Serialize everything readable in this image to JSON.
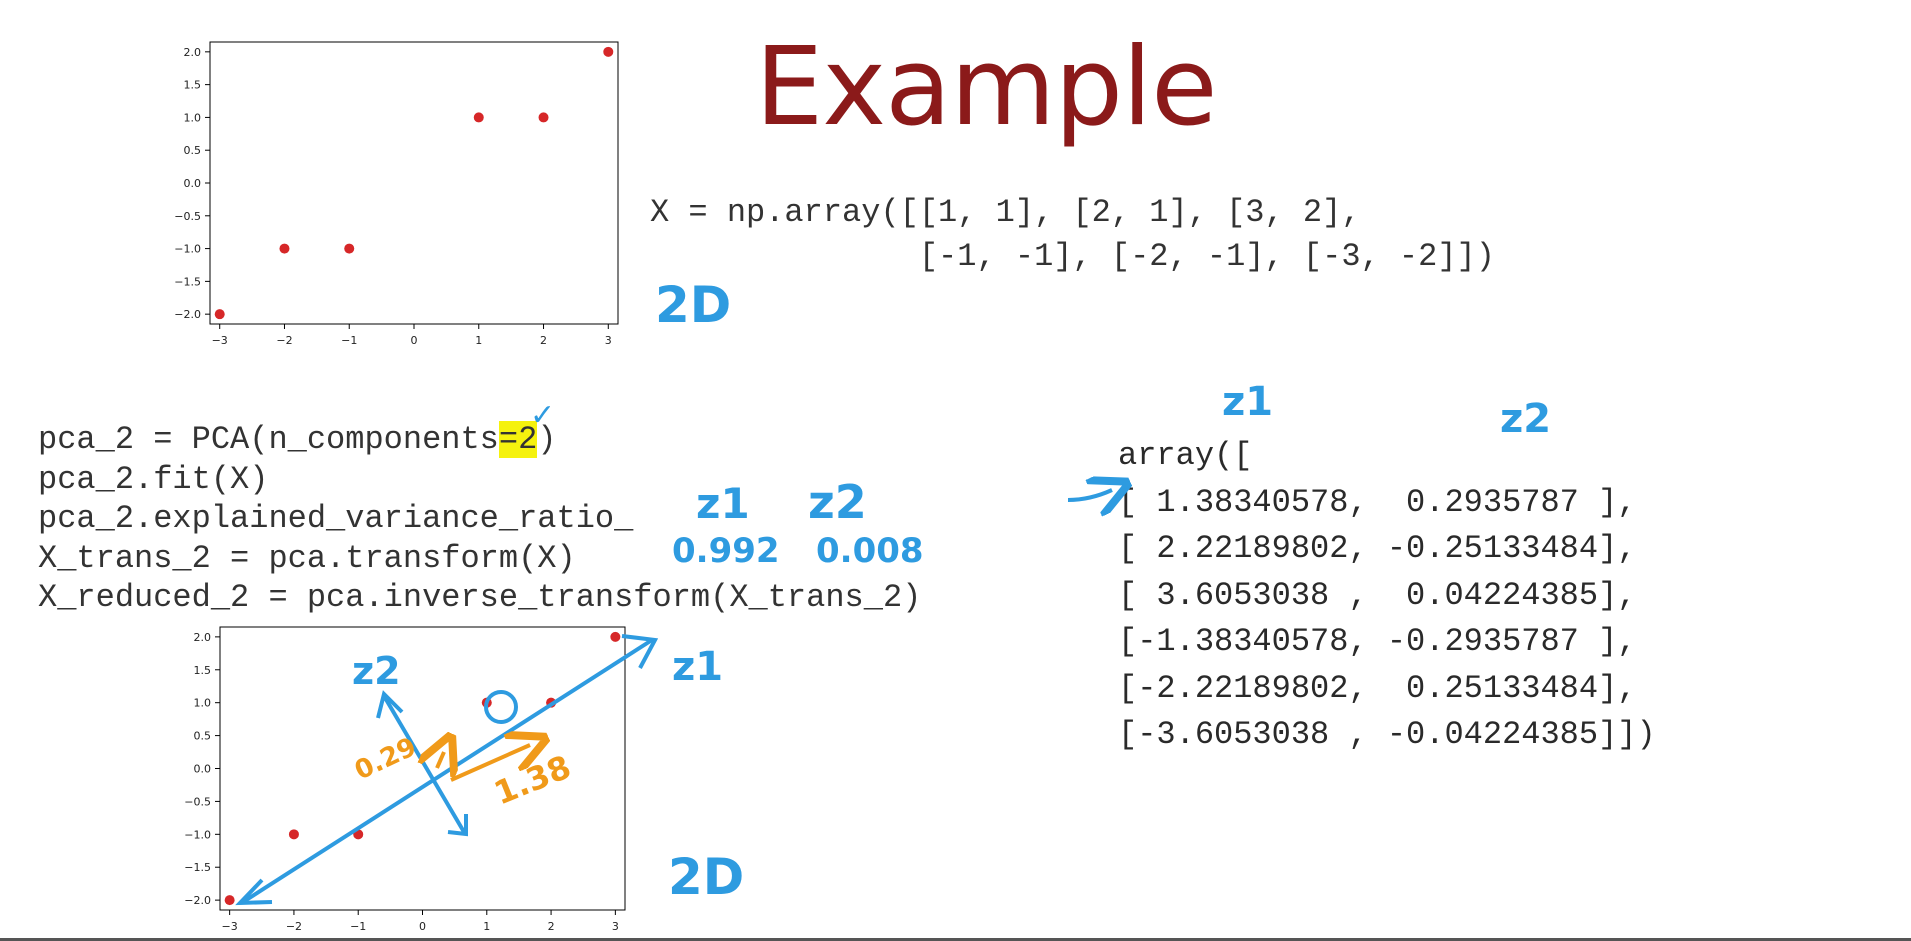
{
  "slide": {
    "title": "Example"
  },
  "code_array": {
    "line1": "X = np.array([[1, 1], [2, 1], [3, 2],",
    "line2": "              [-1, -1], [-2, -1], [-3, -2]])"
  },
  "code_pca": {
    "line1_pre": "pca_2 = PCA(n_components=",
    "line1_hl": "=2",
    "line1_post": ")",
    "line2": "pca_2.fit(X)",
    "line3": "pca_2.explained_variance_ratio_",
    "line4": "X_trans_2 = pca.transform(X)",
    "line5": "X_reduced_2 = pca.inverse_transform(X_trans_2)"
  },
  "output": {
    "header": "array([",
    "rows": [
      "[ 1.38340578,  0.2935787 ],",
      "[ 2.22189802, -0.25133484],",
      "[ 3.6053038 ,  0.04224385],",
      "[-1.38340578, -0.2935787 ],",
      "[-2.22189802,  0.25133484],",
      "[-3.6053038 , -0.04224385]])"
    ]
  },
  "handwriting": {
    "two_d": "2D",
    "z1": "z1",
    "z2": "z2",
    "ratio_z1": "0.992",
    "ratio_z2": "0.008",
    "len_z1": "1.38",
    "len_z2": "0.29",
    "check": "✓"
  },
  "colors": {
    "title": "#8b1a1a",
    "point": "#d62728",
    "ink_blue": "#2e9be0",
    "ink_orange": "#f09a1a",
    "highlight": "#f5f20e"
  },
  "chart_data": [
    {
      "type": "scatter",
      "x": [
        1,
        2,
        3,
        -1,
        -2,
        -3
      ],
      "y": [
        1,
        1,
        2,
        -1,
        -1,
        -2
      ],
      "xticks": [
        "−3",
        "−2",
        "−1",
        "0",
        "1",
        "2",
        "3"
      ],
      "yticks": [
        "2.0",
        "1.5",
        "1.0",
        "0.5",
        "0.0",
        "−0.5",
        "−1.0",
        "−1.5",
        "−2.0"
      ],
      "xlim": [
        -3.15,
        3.15
      ],
      "ylim": [
        -2.15,
        2.15
      ]
    },
    {
      "type": "scatter",
      "x": [
        1,
        2,
        3,
        -1,
        -2,
        -3
      ],
      "y": [
        1,
        1,
        2,
        -1,
        -1,
        -2
      ],
      "xticks": [
        "−3",
        "−2",
        "−1",
        "0",
        "1",
        "2",
        "3"
      ],
      "yticks": [
        "2.0",
        "1.5",
        "1.0",
        "0.5",
        "0.0",
        "−0.5",
        "−1.0",
        "−1.5",
        "−2.0"
      ],
      "xlim": [
        -3.15,
        3.15
      ],
      "ylim": [
        -2.15,
        2.15
      ]
    }
  ]
}
